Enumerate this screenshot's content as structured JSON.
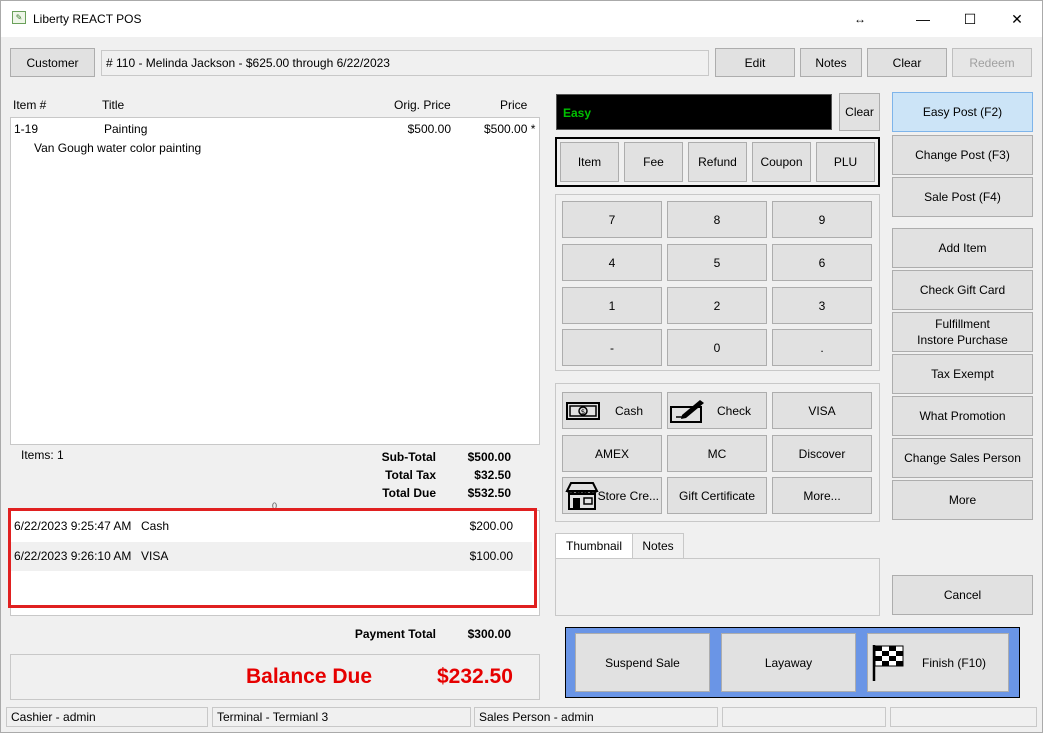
{
  "window": {
    "title": "Liberty REACT POS",
    "colors": {
      "balance_due": "#e60000",
      "display_text": "#00c000",
      "highlight_box": "#e02020",
      "finish_panel": "#6a95e6"
    }
  },
  "header": {
    "customer_button": "Customer",
    "customer_info": "# 110 - Melinda Jackson -  $625.00 through 6/22/2023",
    "edit_button": "Edit",
    "notes_button": "Notes",
    "clear_button": "Clear",
    "redeem_button": "Redeem"
  },
  "items_table": {
    "columns": [
      "Item #",
      "Title",
      "Orig. Price",
      "Price"
    ],
    "rows": [
      {
        "item_no": "1-19",
        "title": "Painting",
        "orig_price": "$500.00",
        "price": "$500.00 *",
        "description": "Van Gough water color painting"
      }
    ]
  },
  "totals": {
    "items_label": "Items: 1",
    "subtotal_label": "Sub-Total",
    "subtotal": "$500.00",
    "tax_label": "Total Tax",
    "tax": "$32.50",
    "due_label": "Total Due",
    "due": "$532.50",
    "stray_mark": "0"
  },
  "payments": [
    {
      "datetime": "6/22/2023 9:25:47 AM",
      "method": "Cash",
      "amount": "$200.00"
    },
    {
      "datetime": "6/22/2023 9:26:10 AM",
      "method": "VISA",
      "amount": "$100.00"
    }
  ],
  "payment_total": {
    "label": "Payment Total",
    "value": "$300.00"
  },
  "balance": {
    "label": "Balance Due",
    "value": "$232.50"
  },
  "entry": {
    "display": "Easy",
    "clear_button": "Clear"
  },
  "entry_types": [
    "Item",
    "Fee",
    "Refund",
    "Coupon",
    "PLU"
  ],
  "keypad": [
    "7",
    "8",
    "9",
    "4",
    "5",
    "6",
    "1",
    "2",
    "3",
    "-",
    "0",
    "."
  ],
  "tenders": {
    "cash": "Cash",
    "check": "Check",
    "visa": "VISA",
    "amex": "AMEX",
    "mc": "MC",
    "discover": "Discover",
    "store_credit": "Store Cre...",
    "gift_certificate": "Gift Certificate",
    "more": "More..."
  },
  "tabs": {
    "thumbnail": "Thumbnail",
    "notes": "Notes"
  },
  "right_buttons": {
    "easy_post": "Easy Post (F2)",
    "change_post": "Change Post (F3)",
    "sale_post": "Sale Post (F4)",
    "add_item": "Add Item",
    "check_gift_card": "Check Gift Card",
    "fulfillment_line1": "Fulfillment",
    "fulfillment_line2": "Instore Purchase",
    "tax_exempt": "Tax Exempt",
    "what_promotion": "What Promotion",
    "change_sales_person": "Change Sales Person",
    "more": "More",
    "cancel": "Cancel"
  },
  "finish_panel": {
    "suspend_sale": "Suspend Sale",
    "layaway": "Layaway",
    "finish": "Finish (F10)"
  },
  "status_bar": {
    "cashier": "Cashier - admin",
    "terminal": "Terminal - Termianl 3",
    "sales_person": "Sales Person - admin"
  }
}
